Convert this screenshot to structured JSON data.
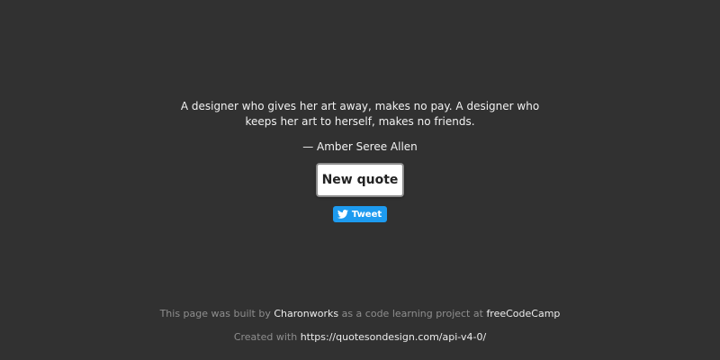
{
  "quote": {
    "text": "A designer who gives her art away, makes no pay. A designer who keeps her art to herself, makes no friends.",
    "author": "— Amber Seree Allen"
  },
  "actions": {
    "new_quote_label": "New quote",
    "tweet_label": "Tweet",
    "tweet_icon": "twitter-bird-icon"
  },
  "footer": {
    "line1_prefix": "This page was built by",
    "line1_author_link": "Charonworks",
    "line1_middle": "as a code learning project at",
    "line1_fcc_link": "freeCodeCamp",
    "line2_prefix": "Created with",
    "line2_api_link": "https://quotesondesign.com/api-v4-0/"
  },
  "colors": {
    "background": "#313131",
    "tweet_blue": "#1d9bf0",
    "muted_text": "#8e8e8e",
    "link_text": "#ededed"
  }
}
